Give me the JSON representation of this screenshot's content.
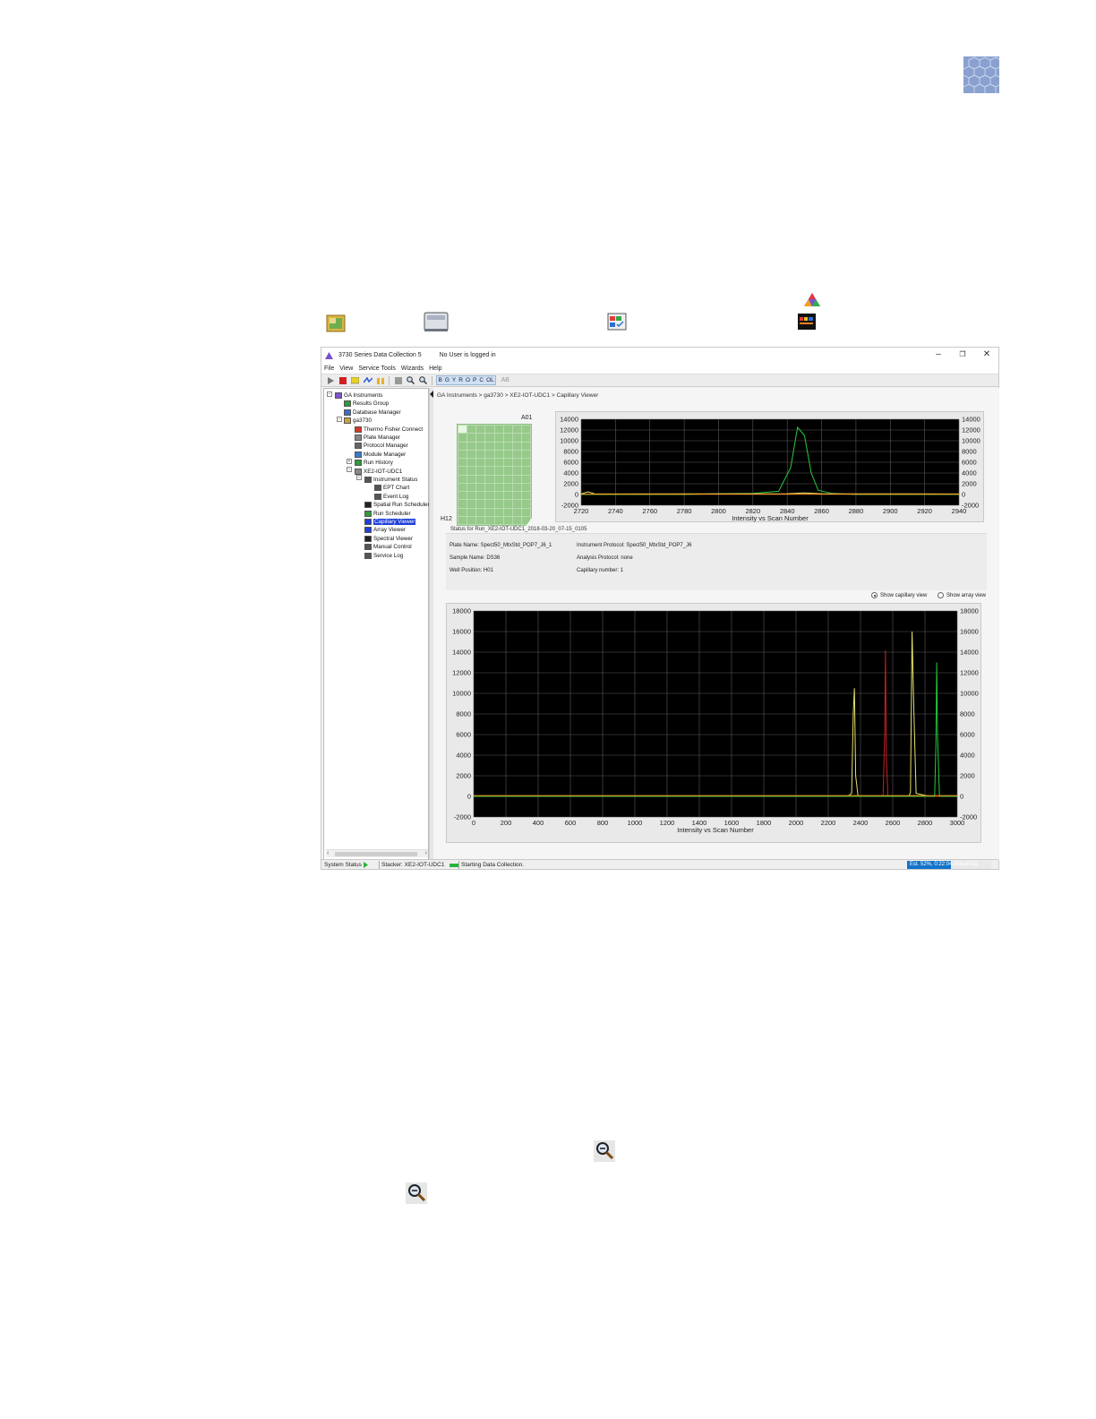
{
  "window": {
    "title": "3730 Series Data Collection 5",
    "user_status": "No User is logged in",
    "minimize": "–",
    "restore": "❐",
    "close": "✕"
  },
  "menu": [
    "File",
    "View",
    "Service Tools",
    "Wizards",
    "Help"
  ],
  "toolbar": {
    "dyes": [
      "B",
      "G",
      "Y",
      "R",
      "O",
      "P",
      "C",
      "OL"
    ],
    "last_icon_label": "AB"
  },
  "tree": [
    {
      "label": "GA Instruments",
      "icon": "instruments-icon",
      "color": "#7a55c8"
    },
    {
      "label": "Results Group",
      "icon": "results-group-icon",
      "color": "#2e9b3d"
    },
    {
      "label": "Database Manager",
      "icon": "database-icon",
      "color": "#3a6fc9"
    },
    {
      "label": "ga3730",
      "icon": "instrument-folder-icon",
      "color": "#c9a23a"
    },
    {
      "label": "Thermo Fisher Connect",
      "icon": "connect-icon",
      "color": "#d23a2a"
    },
    {
      "label": "Plate Manager",
      "icon": "plate-manager-icon",
      "color": "#888888"
    },
    {
      "label": "Protocol Manager",
      "icon": "protocol-manager-icon",
      "color": "#666666"
    },
    {
      "label": "Module Manager",
      "icon": "module-manager-icon",
      "color": "#3a7ac9"
    },
    {
      "label": "Run History",
      "icon": "run-history-icon",
      "color": "#2e9b3d"
    },
    {
      "label": "XE2-IOT-UDC1",
      "icon": "instrument-icon",
      "color": "#888888"
    },
    {
      "label": "Instrument Status",
      "icon": "instrument-status-icon",
      "color": "#555555"
    },
    {
      "label": "EPT Chart",
      "icon": "ept-chart-icon",
      "color": "#555555"
    },
    {
      "label": "Event Log",
      "icon": "event-log-icon",
      "color": "#555555"
    },
    {
      "label": "Spatial Run Scheduler",
      "icon": "spatial-scheduler-icon",
      "color": "#222222"
    },
    {
      "label": "Run Scheduler",
      "icon": "run-scheduler-icon",
      "color": "#2e9b3d"
    },
    {
      "label": "Capillary Viewer",
      "icon": "capillary-viewer-icon",
      "color": "#1f3fd9"
    },
    {
      "label": "Array Viewer",
      "icon": "array-viewer-icon",
      "color": "#1f3fd9"
    },
    {
      "label": "Spectral Viewer",
      "icon": "spectral-viewer-icon",
      "color": "#222222"
    },
    {
      "label": "Manual Control",
      "icon": "manual-control-icon",
      "color": "#555555"
    },
    {
      "label": "Service Log",
      "icon": "service-log-icon",
      "color": "#555555"
    }
  ],
  "selected_tree_item": "Capillary Viewer",
  "breadcrumb": "GA Instruments > ga3730 > XE2-IOT-UDC1 > Capillary Viewer",
  "plate": {
    "top_label": "A01",
    "bottom_label": "H12",
    "rows": 12,
    "cols": 8
  },
  "status": {
    "title": "Status for Run_XE2-IOT-UDC1_2018-03-20_07-15_0105",
    "plate_name": "Plate Name: Spect50_MtxStd_POP7_J6_1",
    "instrument_protocol": "Instrument Protocol: Spect50_MtxStd_POP7_J6",
    "sample_name": "Sample Name: DS36",
    "analysis_protocol": "Analysis Protocol: none",
    "well_position": "Well Position: H01",
    "capillary_number": "Capillary number: 1"
  },
  "view_options": {
    "capillary": "Show capillary view",
    "array": "Show array view",
    "selected": "capillary"
  },
  "statusbar": {
    "system_status": "System Status",
    "stacker": "Stacker: XE2-IOT-UDC1",
    "message": "Starting Data Collection.",
    "progress_text": "Est. 52%, 0:22:04 remaining.",
    "progress_fraction": 0.52
  },
  "colors": {
    "plot_bg": "#000000",
    "grid": "#5a5a5a",
    "green": "#27c93f",
    "yellow": "#e8e26a",
    "red": "#c82020",
    "orange": "#ff8c1a",
    "selection": "#1f3fd9",
    "progress": "#1273c9"
  },
  "chart_data": [
    {
      "type": "line",
      "title": "",
      "xlabel": "Intensity vs Scan Number",
      "ylabel": "",
      "xlim": [
        2720,
        2940
      ],
      "ylim": [
        -2000,
        14000
      ],
      "x_ticks": [
        "2720",
        "2740",
        "2760",
        "2780",
        "2800",
        "2820",
        "2840",
        "2860",
        "2880",
        "2900",
        "2920",
        "2940"
      ],
      "y_ticks": [
        "14000",
        "12000",
        "10000",
        "8000",
        "6000",
        "4000",
        "2000",
        "0",
        "-2000"
      ],
      "grid": true,
      "series": [
        {
          "color": "#27c93f",
          "x": [
            2720,
            2780,
            2800,
            2820,
            2835,
            2842,
            2846,
            2850,
            2854,
            2858,
            2866,
            2880,
            2940
          ],
          "y": [
            0,
            0,
            150,
            200,
            600,
            5000,
            12500,
            11000,
            4000,
            800,
            200,
            0,
            0
          ]
        },
        {
          "color": "#e8e26a",
          "x": [
            2720,
            2724,
            2728,
            2840,
            2850,
            2860,
            2940
          ],
          "y": [
            100,
            500,
            100,
            150,
            300,
            150,
            100
          ]
        },
        {
          "color": "#ff8c1a",
          "x": [
            2720,
            2940
          ],
          "y": [
            60,
            60
          ]
        }
      ]
    },
    {
      "type": "line",
      "title": "",
      "xlabel": "Intensity vs Scan Number",
      "ylabel": "",
      "xlim": [
        0,
        3000
      ],
      "ylim": [
        -2000,
        18000
      ],
      "x_ticks": [
        "0",
        "200",
        "400",
        "600",
        "800",
        "1000",
        "1200",
        "1400",
        "1600",
        "1800",
        "2000",
        "2200",
        "2400",
        "2600",
        "2800",
        "3000"
      ],
      "y_ticks": [
        "18000",
        "16000",
        "14000",
        "12000",
        "10000",
        "8000",
        "6000",
        "4000",
        "2000",
        "0",
        "-2000"
      ],
      "right_y_ticks": [
        "18000",
        "16000",
        "14000",
        "12000",
        "10000",
        "8000",
        "6000",
        "4000",
        "2000",
        "0",
        "-2000"
      ],
      "grid": true,
      "series": [
        {
          "color": "#e8e26a",
          "x": [
            0,
            2320,
            2345,
            2355,
            2362,
            2370,
            2385,
            2700,
            2710,
            2720,
            2730,
            2745,
            2830,
            3000
          ],
          "y": [
            0,
            0,
            300,
            8000,
            10500,
            2000,
            0,
            0,
            400,
            16000,
            9000,
            300,
            0,
            0
          ]
        },
        {
          "color": "#c82020",
          "x": [
            0,
            2540,
            2550,
            2555,
            2560,
            2570,
            3000
          ],
          "y": [
            0,
            0,
            6000,
            14200,
            4000,
            0,
            0
          ]
        },
        {
          "color": "#27c93f",
          "x": [
            0,
            2860,
            2868,
            2873,
            2878,
            2890,
            3000
          ],
          "y": [
            0,
            0,
            5000,
            13000,
            6000,
            0,
            0
          ]
        },
        {
          "color": "#ff8c1a",
          "x": [
            0,
            3000
          ],
          "y": [
            80,
            80
          ]
        }
      ]
    }
  ]
}
